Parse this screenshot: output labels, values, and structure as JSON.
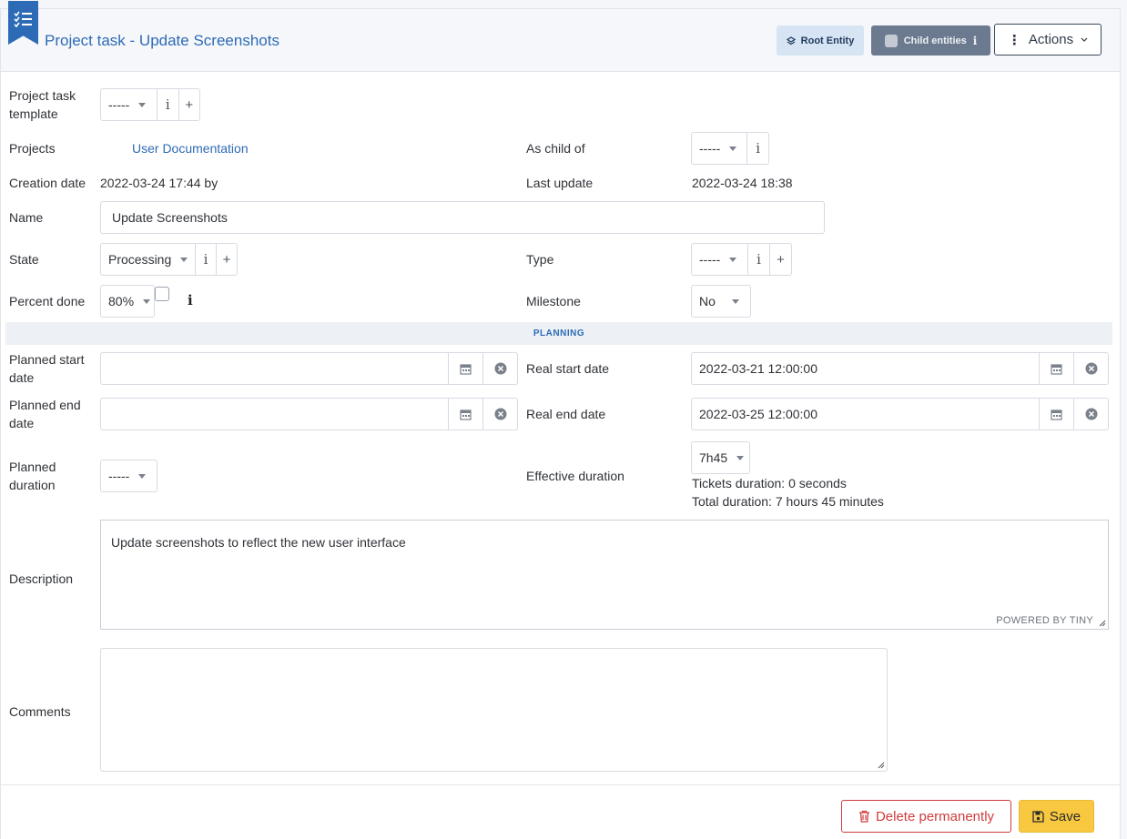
{
  "header": {
    "title": "Project task - Update Screenshots",
    "root_entity_label": "Root Entity",
    "child_entities_label": "Child entities",
    "actions_label": "Actions"
  },
  "form": {
    "project_task_template": {
      "label": "Project task template",
      "label_line1": "Project task",
      "label_line2": "template",
      "value": "-----"
    },
    "projects": {
      "label": "Projects",
      "value": "User Documentation"
    },
    "as_child_of": {
      "label": "As child of",
      "value": "-----"
    },
    "creation_date": {
      "label": "Creation date",
      "value": "2022-03-24 17:44 by"
    },
    "last_update": {
      "label": "Last update",
      "value": "2022-03-24 18:38"
    },
    "name": {
      "label": "Name",
      "value": "Update Screenshots"
    },
    "state": {
      "label": "State",
      "value": "Processing"
    },
    "type": {
      "label": "Type",
      "value": "-----"
    },
    "percent_done": {
      "label": "Percent done",
      "value": "80%",
      "percent": 80
    },
    "milestone": {
      "label": "Milestone",
      "value": "No"
    },
    "planning_section": "PLANNING",
    "planned_start_date": {
      "label_line1": "Planned start",
      "label_line2": "date",
      "value": ""
    },
    "real_start_date": {
      "label": "Real start date",
      "value": "2022-03-21 12:00:00"
    },
    "planned_end_date": {
      "label_line1": "Planned end",
      "label_line2": "date",
      "value": ""
    },
    "real_end_date": {
      "label": "Real end date",
      "value": "2022-03-25 12:00:00"
    },
    "planned_duration": {
      "label_line1": "Planned",
      "label_line2": "duration",
      "value": "-----"
    },
    "effective_duration": {
      "label": "Effective duration",
      "value": "7h45",
      "tickets_duration": "Tickets duration: 0 seconds",
      "total_duration": "Total duration: 7 hours 45 minutes"
    },
    "description": {
      "label": "Description",
      "value": "Update screenshots to reflect the new user interface",
      "powered_by": "POWERED BY TINY"
    },
    "comments": {
      "label": "Comments",
      "value": ""
    }
  },
  "footer": {
    "delete_label": "Delete permanently",
    "save_label": "Save"
  },
  "colors": {
    "accent": "#2e6bb6",
    "danger": "#cf3c3c",
    "save": "#f8c840"
  }
}
